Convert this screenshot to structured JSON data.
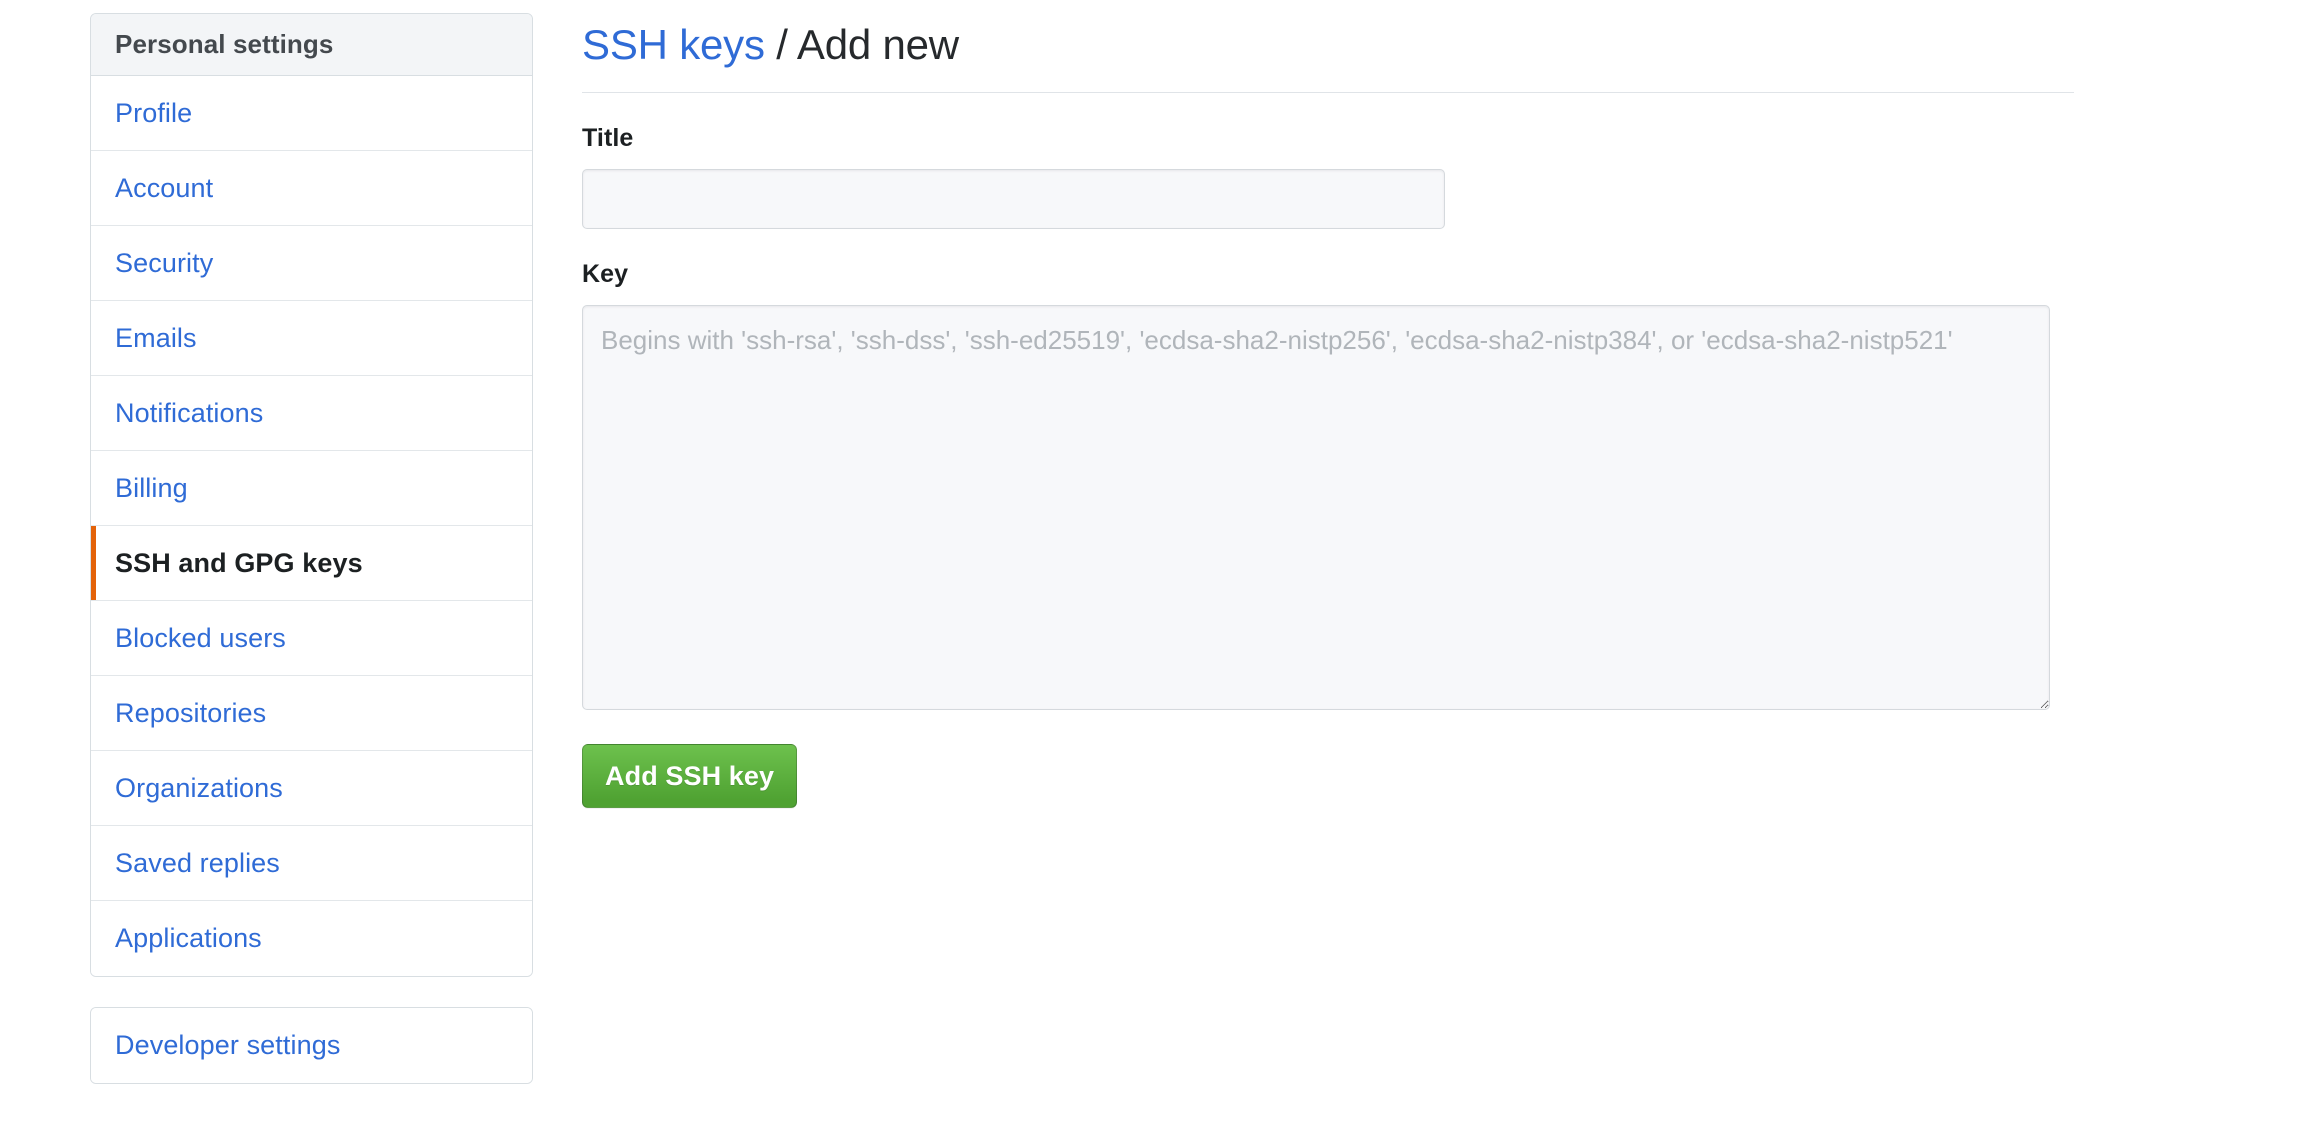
{
  "sidebar": {
    "header": "Personal settings",
    "items": [
      {
        "label": "Profile",
        "selected": false
      },
      {
        "label": "Account",
        "selected": false
      },
      {
        "label": "Security",
        "selected": false
      },
      {
        "label": "Emails",
        "selected": false
      },
      {
        "label": "Notifications",
        "selected": false
      },
      {
        "label": "Billing",
        "selected": false
      },
      {
        "label": "SSH and GPG keys",
        "selected": true
      },
      {
        "label": "Blocked users",
        "selected": false
      },
      {
        "label": "Repositories",
        "selected": false
      },
      {
        "label": "Organizations",
        "selected": false
      },
      {
        "label": "Saved replies",
        "selected": false
      },
      {
        "label": "Applications",
        "selected": false
      }
    ],
    "developer_settings": "Developer settings",
    "selected_indicator_color": "#e36209"
  },
  "main": {
    "heading": {
      "link_text": "SSH keys",
      "separator": "/",
      "current": "Add new"
    },
    "title_field": {
      "label": "Title",
      "value": "",
      "placeholder": ""
    },
    "key_field": {
      "label": "Key",
      "value": "",
      "placeholder": "Begins with 'ssh-rsa', 'ssh-dss', 'ssh-ed25519', 'ecdsa-sha2-nistp256', 'ecdsa-sha2-nistp384', or 'ecdsa-sha2-nistp521'"
    },
    "submit_button": "Add SSH key"
  },
  "colors": {
    "link": "#2f6bd6",
    "accent_orange": "#e36209",
    "button_green": "#55a532",
    "text_dark": "#1c2022",
    "border": "#d8dee2",
    "input_bg": "#f7f8fa",
    "header_bg": "#f3f5f7"
  }
}
